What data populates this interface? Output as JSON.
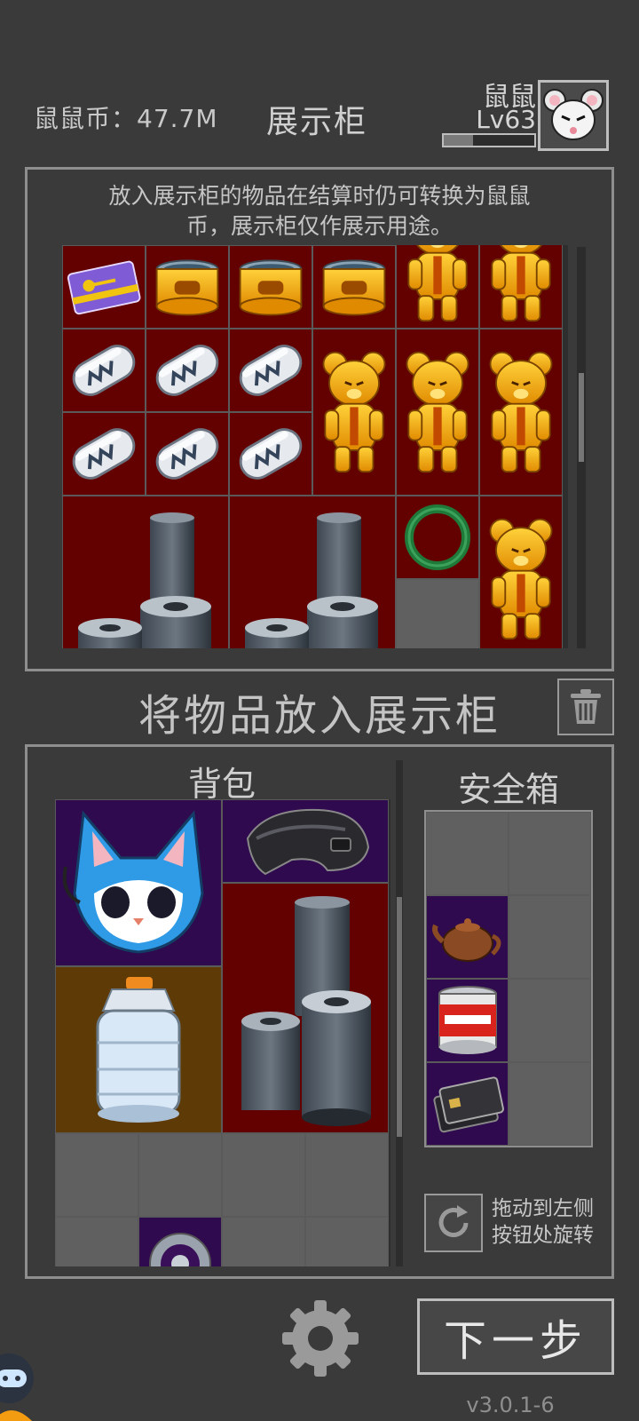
{
  "header": {
    "coins": "鼠鼠币：47.7M",
    "title": "展示柜",
    "player_name": "鼠鼠",
    "player_level": "Lv63",
    "xp_fraction": 0.32,
    "avatar_icon": "white-mouse-avatar"
  },
  "showcase": {
    "notice_line1": "放入展示柜的物品在结算时仍可转换为鼠鼠",
    "notice_line2": "币，展示柜仅作展示用途。",
    "items": [
      "purple-keycard-icon",
      "gold-tin-icon",
      "gold-tin-icon",
      "gold-tin-icon",
      "gold-bear-figure-icon",
      "gold-bear-figure-icon",
      "glass-capsule-icon",
      "glass-capsule-icon",
      "glass-capsule-icon",
      "glass-capsule-icon",
      "glass-capsule-icon",
      "glass-capsule-icon",
      "gold-bear-figure-icon",
      "gold-bear-figure-icon",
      "gold-bear-figure-icon",
      "dark-roller-stack-icon",
      "dark-roller-stack-icon",
      "jade-ring-icon",
      "gold-bear-figure-icon"
    ]
  },
  "put_label": "将物品放入展示柜",
  "trash_icon": "trash-icon",
  "backpack": {
    "title": "背包",
    "items": [
      "blue-cat-mask-icon",
      "black-helmet-icon",
      "cryo-container-icon",
      "dark-roller-stack-icon",
      "gear-badge-icon"
    ]
  },
  "safe": {
    "title": "安全箱",
    "items": [
      "teapot-icon",
      "red-can-icon",
      "black-cards-icon"
    ]
  },
  "rotate": {
    "icon": "rotate-icon",
    "hint_line1": "拖动到左侧",
    "hint_line2": "按钮处旋转"
  },
  "footer": {
    "settings_icon": "gear-icon",
    "next_label": "下一步",
    "version": "v3.0.1-6"
  },
  "colors": {
    "background": "#3a3a3a",
    "cell_red": "#630000",
    "cell_purple": "#2f0a4e",
    "cell_brown": "#5e3a07",
    "cell_grey": "#606060"
  }
}
